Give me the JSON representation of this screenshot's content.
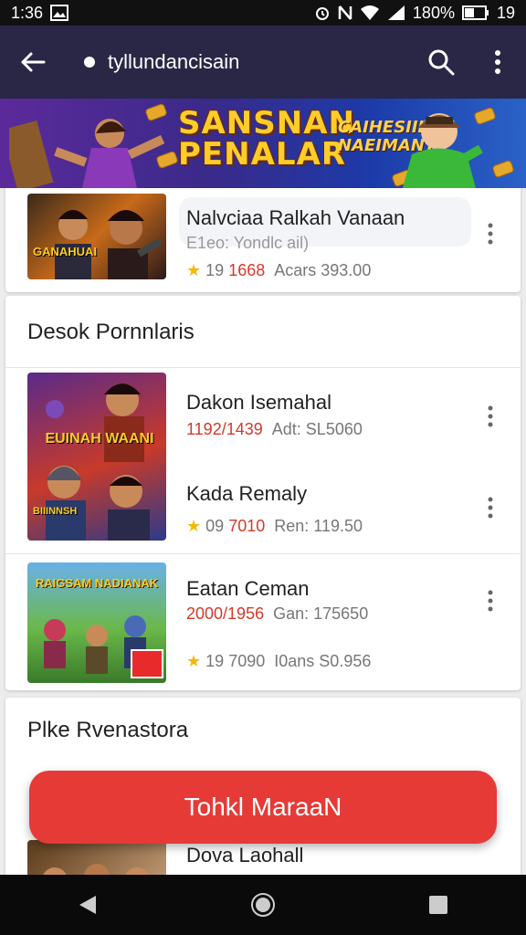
{
  "status_bar": {
    "time": "1:36",
    "battery_text": "180%",
    "extra": "19"
  },
  "app_bar": {
    "title": "tyllundancisain"
  },
  "banner": {
    "headline_line1": "SANSNAN",
    "headline_line2": "PENALAR",
    "sub_line1": "CAIHESIII",
    "sub_line2": "NAEIMANT"
  },
  "featured": {
    "name": "Nalvciaa Ralkah Vanaan",
    "subtitle": "E1eo: Yondlc ail)",
    "rating": "19",
    "rating_red": "1668",
    "price": "Acars 393.00",
    "thumb_text": "GANAHUAI"
  },
  "section1": {
    "title": "Desok Pornnlaris",
    "items": [
      {
        "name": "Dakon Isemahal",
        "meta_red": "1192/1439",
        "meta": "Adt: SL5060",
        "thumb_text": "EUINAH WAANI"
      },
      {
        "name": "Kada Remaly",
        "meta_star": "09",
        "meta_red": "7010",
        "meta": "Ren: 119.50",
        "thumb_text": "BIIINNSH"
      },
      {
        "name": "Eatan Ceman",
        "meta_red": "2000/1956",
        "meta": "Gan: 175650",
        "rating": "19",
        "rating_mid": "7090",
        "price": "I0ans S0.956",
        "thumb_text": "RAIGSAM NADIANAK"
      }
    ]
  },
  "section2": {
    "title": "Plke Rvenastora",
    "partial_item_name": "Dova Laohall"
  },
  "cta": {
    "label": "Tohkl MaraaN"
  },
  "colors": {
    "app_bar": "#2a2746",
    "cta": "#e63a36",
    "accent_red": "#d23a2a",
    "star": "#f2b90c"
  }
}
